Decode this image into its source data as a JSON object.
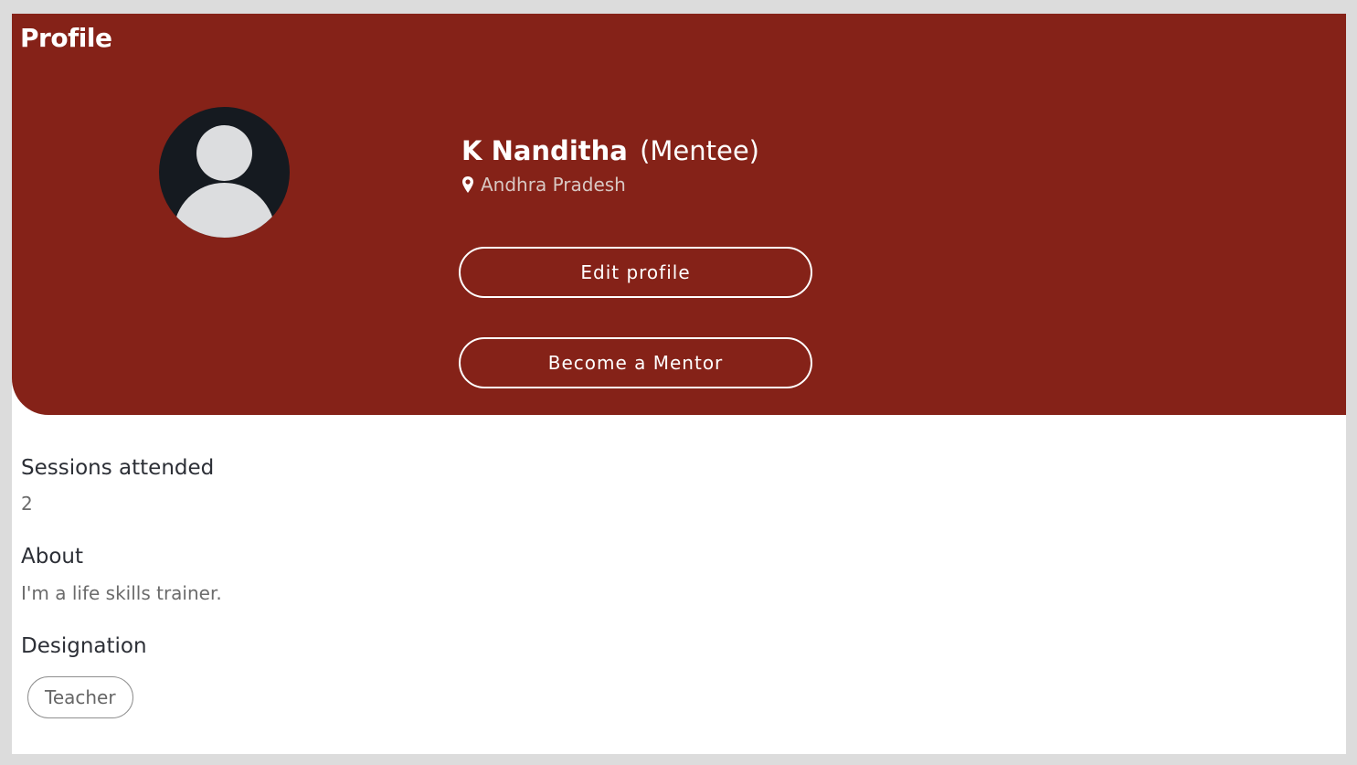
{
  "page": {
    "title": "Profile"
  },
  "profile": {
    "name": "K Nanditha",
    "role": "(Mentee)",
    "location": "Andhra Pradesh",
    "avatar_icon": "default-user-avatar-icon",
    "location_icon": "map-pin-icon"
  },
  "actions": {
    "edit_label": "Edit profile",
    "mentor_label": "Become a Mentor"
  },
  "details": {
    "sessions_label": "Sessions attended",
    "sessions_value": "2",
    "about_label": "About",
    "about_value": "I'm a life skills trainer.",
    "designation_label": "Designation",
    "designations": [
      "Teacher"
    ]
  },
  "colors": {
    "header_bg": "#852218",
    "page_bg": "#dcdcdc",
    "card_bg": "#ffffff"
  }
}
